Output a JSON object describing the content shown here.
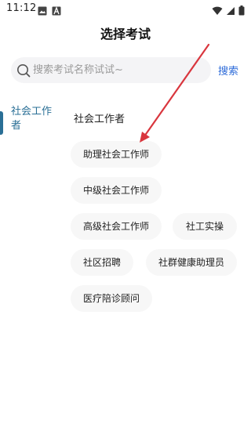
{
  "status_bar": {
    "time": "11:12",
    "left_icons": [
      "image-icon",
      "app-a-icon"
    ],
    "right_icons": [
      "wifi-icon",
      "signal-icon",
      "battery-icon"
    ]
  },
  "header": {
    "title": "选择考试"
  },
  "search": {
    "placeholder": "搜索考试名称试试~",
    "button_label": "搜索"
  },
  "sidebar": {
    "items": [
      {
        "label": "社会工作者",
        "selected": true
      }
    ]
  },
  "main": {
    "category_title": "社会工作者",
    "exams": [
      {
        "label": "助理社会工作师"
      },
      {
        "label": "中级社会工作师"
      },
      {
        "label": "高级社会工作师"
      },
      {
        "label": "社工实操"
      },
      {
        "label": "社区招聘"
      },
      {
        "label": "社群健康助理员"
      },
      {
        "label": "医疗陪诊顾问"
      }
    ]
  },
  "colors": {
    "accent": "#2a6f96",
    "search_button": "#2d6bd9",
    "annotation_arrow": "#d9363e"
  }
}
